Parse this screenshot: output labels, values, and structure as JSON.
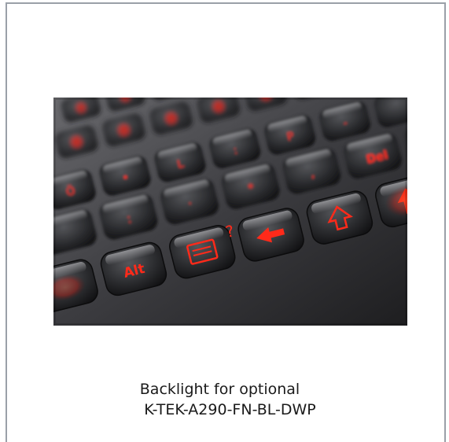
{
  "image": {
    "alt": "Backlit keyboard keys with red illuminated legends",
    "icon": "keyboard-photo"
  },
  "caption": {
    "line1": "Backlight for optional",
    "line2": "K-TEK-A290-FN-BL-DWP"
  },
  "colors": {
    "frame_border": "#9aa0a8",
    "key_glow": "#ff2a1a",
    "key_body": "#2b2b2e"
  }
}
